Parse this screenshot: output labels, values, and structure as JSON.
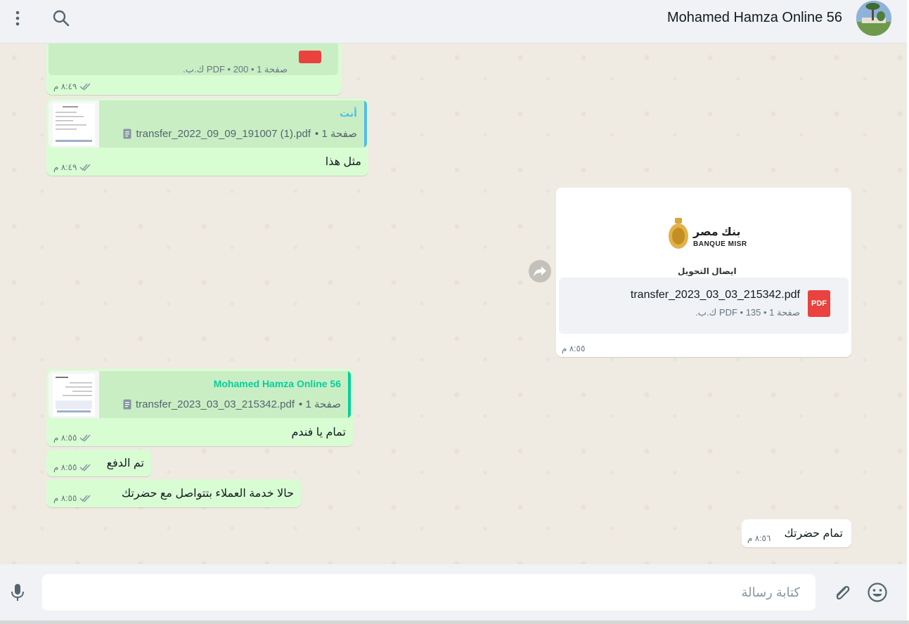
{
  "header": {
    "title": "Mohamed Hamza Online 56"
  },
  "messages": {
    "m1": {
      "meta": "PDF • 200 ك.ب.",
      "pages": "صفحة 1",
      "time": "٨:٤٩ م"
    },
    "m2": {
      "quote_author": "أنت",
      "quote_file": "transfer_2022_09_09_191007 (1).pdf",
      "quote_pages": "صفحة 1 •",
      "text": "مثل هذا",
      "time": "٨:٤٩ م"
    },
    "m3": {
      "bank_name_ar": "بنك مصر",
      "bank_name_en": "BANQUE MISR",
      "doc_title": "ايصال التحويل",
      "file_name": "transfer_2023_03_03_215342.pdf",
      "pages": "صفحة 1",
      "meta": "PDF • 135 ك.ب.",
      "badge": "PDF",
      "time": "٨:٥٥ م"
    },
    "m4": {
      "quote_author": "Mohamed Hamza Online 56",
      "quote_file": "transfer_2023_03_03_215342.pdf",
      "quote_pages": "صفحة 1 •",
      "text": "تمام يا فندم",
      "time": "٨:٥٥ م"
    },
    "m5": {
      "text": "تم الدفع",
      "time": "٨:٥٥ م"
    },
    "m6": {
      "text": "حالا خدمة العملاء بتتواصل مع حضرتك",
      "time": "٨:٥٥ م"
    },
    "m7": {
      "text": "تمام حضرتك",
      "time": "٨:٥٦ م"
    }
  },
  "composer": {
    "placeholder": "كتابة رسالة"
  },
  "colors": {
    "outgoing_bubble": "#d9fdd3",
    "incoming_bubble": "#ffffff",
    "quote_bar_self": "#53bdeb",
    "quote_bar_other": "#06cf9c",
    "pdf_red": "#e9423f"
  }
}
